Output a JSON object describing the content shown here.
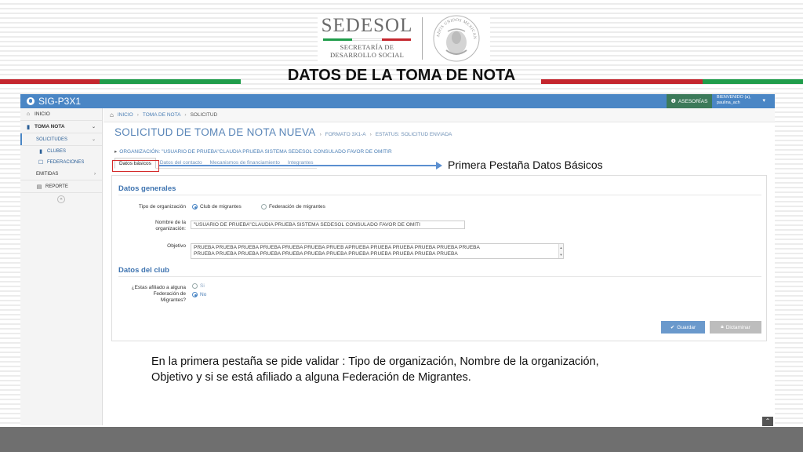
{
  "slide": {
    "brand_name": "SEDESOL",
    "brand_sub_1": "SECRETARÍA DE",
    "brand_sub_2": "DESARROLLO SOCIAL",
    "seal_text": "ESTADOS UNIDOS MEXICANOS",
    "title": "DATOS DE LA TOMA DE NOTA",
    "callout": "Primera Pestaña Datos Básicos",
    "description": "En la primera pestaña se pide validar : Tipo de organización, Nombre de la organización, Objetivo y si se está afiliado a alguna Federación de Migrantes."
  },
  "colors": {
    "stripe_red": "#c4262e",
    "stripe_green": "#1f9c4a",
    "app_blue": "#4a86c5",
    "advisory_green": "#3c7a5a",
    "callout_red": "#d42a2a",
    "arrow_blue": "#5b8fd0"
  },
  "app": {
    "name": "SIG-P3X1",
    "advisory_label": "ASESORÍAS",
    "advisory_icon": "info-icon",
    "user_line_1": "BIENVENIDO (a),",
    "user_line_2": "paulina_ach",
    "user_caret": "▾"
  },
  "sidebar": {
    "inicio": "INICIO",
    "toma_nota": "TOMA NOTA",
    "solicitudes": "SOLICITUDES",
    "clubes": "CLUBES",
    "federaciones": "FEDERACIONES",
    "emitidas": "EMITIDAS",
    "reporte": "REPORTE",
    "collapse": "«"
  },
  "breadcrumb": {
    "items": [
      "INICIO",
      "TOMA DE NOTA",
      "SOLICITUD"
    ]
  },
  "page": {
    "title": "SOLICITUD DE TOMA DE NOTA NUEVA",
    "format": "FORMATO 3X1-A",
    "status": "ESTATUS: SOLICITUD ENVIADA",
    "organization": "ORGANIZACIÓN: \"USUARIO DE PRUEBA\"CLAUDIA PRUEBA SISTEMA SEDESOL CONSULADO FAVOR DE OMITIR"
  },
  "tabs": [
    {
      "label": "Datos básicos"
    },
    {
      "label": "Datos del contacto"
    },
    {
      "label": "Mecanismos de financiamiento"
    },
    {
      "label": "Integrantes"
    }
  ],
  "form": {
    "general_title": "Datos generales",
    "org_type_label": "Tipo de organización",
    "org_type_options": [
      "Club de migrantes",
      "Federación de migrantes"
    ],
    "org_type_selected": "Club de migrantes",
    "org_name_label_1": "Nombre de la",
    "org_name_label_2": "organización:",
    "org_name_value": "\"USUARIO DE PRUEBA\"CLAUDIA PRUEBA SISTEMA SEDESOL CONSULADO FAVOR DE OMITI",
    "objective_label": "Objetivo",
    "objective_line_1": "PRUEBA PRUEBA PRUEBA PRUEBA PRUEBA PRUEBA PRUEB APRUEBA PRUEBA PRUEBA PRUEBA PRUEBA PRUEBA",
    "objective_line_2": "PRUEBA PRUEBA PRUEBA PRUEBA PRUEBA PRUEBA PRUEBA PRUEBA PRUEBA PRUEBA PRUEBA PRUEBA",
    "club_title": "Datos del club",
    "affiliated_label_1": "¿Estas afiliado a alguna",
    "affiliated_label_2": "Federación de",
    "affiliated_label_3": "Migrantes?",
    "affiliated_options": [
      "Si",
      "No"
    ],
    "affiliated_selected": "No",
    "save_label": "Guardar",
    "opinion_label": "Dictaminar"
  },
  "scroll_top": "⌃"
}
